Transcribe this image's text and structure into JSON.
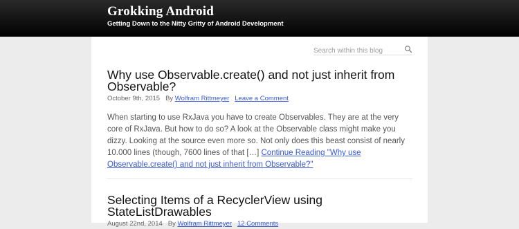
{
  "header": {
    "title": "Grokking Android",
    "description": "Getting Down to the Nitty Gritty of Android Development"
  },
  "search": {
    "placeholder": "Search within this blog",
    "value": "",
    "icon": "search-icon"
  },
  "posts": [
    {
      "title": "Why use Observable.create() and not just inherit from Observable?",
      "date": "October 9th, 2015",
      "by_label": "By",
      "author": "Wolfram Rittmeyer",
      "comments_link": "Leave a Comment",
      "excerpt": "When starting to use RxJava you have to create Observables. They are at the very core of RxJava. But how to do so? A look at the Observable class might make you dizzy. Looking at the source even more so. Not only does this beast consist of nearly 10.000 lines (though, 7600 lines of that […]",
      "continue_link": "Continue Reading \"Why use Observable.create() and not just inherit from Observable?\""
    },
    {
      "title": "Selecting Items of a RecyclerView using StateListDrawables",
      "date": "August 22nd, 2014",
      "by_label": "By",
      "author": "Wolfram Rittmeyer",
      "comments_link": "12 Comments"
    }
  ]
}
